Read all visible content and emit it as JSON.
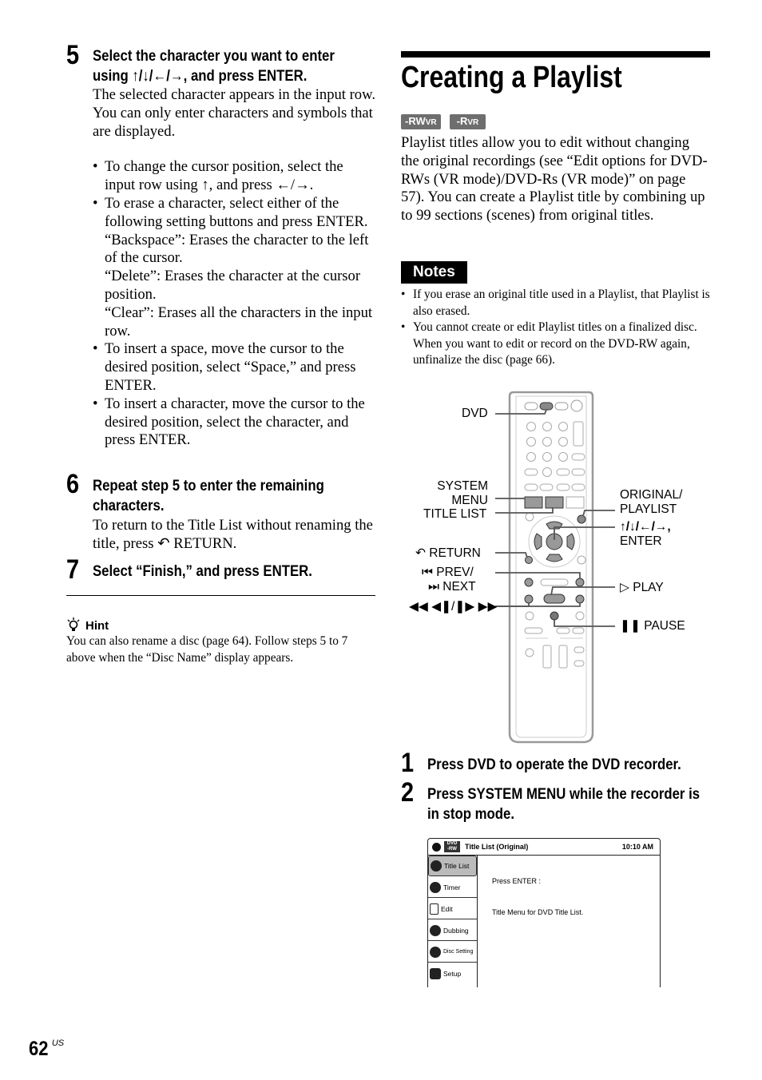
{
  "left_column": {
    "step5": {
      "number": "5",
      "heading_line1": "Select the character you want to enter",
      "heading_line2": "using ↑/↓/←/→, and press ENTER.",
      "para1": "The selected character appears in the input row.",
      "para2": "You can only enter characters and symbols that are displayed.",
      "bullets": [
        "To change the cursor position, select the input row using ↑, and press ←/→.",
        "To erase a character, select either of the following setting buttons and press ENTER.",
        "To insert a space, move the cursor to the desired position, select “Space,” and press ENTER.",
        "To insert a character, move the cursor to the desired position, select the character, and press ENTER."
      ],
      "erase_options": [
        "“Backspace”: Erases the character to the left of the cursor.",
        "“Delete”: Erases the character at the cursor position.",
        "“Clear”: Erases all the characters in the input row."
      ]
    },
    "step6": {
      "number": "6",
      "heading_line1": "Repeat step 5 to enter the remaining",
      "heading_line2": "characters.",
      "para": "To return to the Title List without renaming the title, press ↶ RETURN."
    },
    "step7": {
      "number": "7",
      "heading": "Select “Finish,” and press ENTER."
    },
    "hint": {
      "icon": "lightbulb-icon",
      "label": "Hint",
      "text": "You can also rename a disc (page 64). Follow steps 5 to 7 above when the “Disc Name” display appears."
    }
  },
  "right_column": {
    "title": "Creating a Playlist",
    "badges": [
      {
        "main": "-RW",
        "sub": "VR"
      },
      {
        "main": "-R",
        "sub": "VR"
      }
    ],
    "intro": "Playlist titles allow you to edit without changing the original recordings (see “Edit options for DVD-RWs (VR mode)/DVD-Rs (VR mode)” on page 57). You can create a Playlist title by combining up to 99 sections (scenes) from original titles.",
    "notes": {
      "label": "Notes",
      "items": [
        "If you erase an original title used in a Playlist, that Playlist is also erased.",
        "You cannot create or edit Playlist titles on a finalized disc. When you want to edit or record on the DVD-RW again, unfinalize the disc (page 66)."
      ]
    },
    "remote_labels": {
      "dvd": "DVD",
      "system_menu_1": "SYSTEM",
      "system_menu_2": "MENU",
      "title_list": "TITLE LIST",
      "return": "↶ RETURN",
      "prev": "⏮ PREV/",
      "next": "⏭ NEXT",
      "scan": "◀◀ ◀❚/❚▶ ▶▶",
      "original_1": "ORIGINAL/",
      "original_2": "PLAYLIST",
      "arrows": "↑/↓/←/→,",
      "enter": "ENTER",
      "play": "▷ PLAY",
      "pause": "❚❚ PAUSE"
    },
    "step1": {
      "number": "1",
      "heading": "Press DVD to operate the DVD recorder."
    },
    "step2": {
      "number": "2",
      "heading_line1": "Press SYSTEM MENU while the recorder is",
      "heading_line2": "in stop mode."
    },
    "osd": {
      "disc_label": "DVD -RW",
      "header_title": "Title List (Original)",
      "time": "10:10 AM",
      "menu": [
        {
          "label": "Title List",
          "selected": true
        },
        {
          "label": "Timer",
          "selected": false
        },
        {
          "label": "Edit",
          "selected": false
        },
        {
          "label": "Dubbing",
          "selected": false
        },
        {
          "label": "Disc Setting",
          "selected": false
        },
        {
          "label": "Setup",
          "selected": false
        }
      ],
      "line1": "Press ENTER :",
      "line2": "Title Menu for DVD Title List."
    }
  },
  "footer": {
    "page_number": "62",
    "region": "US"
  }
}
